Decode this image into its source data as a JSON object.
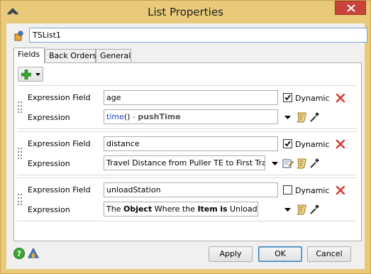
{
  "window": {
    "title": "List Properties"
  },
  "name_field": {
    "value": "TSList1"
  },
  "tabs": [
    {
      "label": "Fields"
    },
    {
      "label": "Back Orders"
    },
    {
      "label": "General"
    }
  ],
  "fields": [
    {
      "field_label": "Expression Field",
      "field_value": "age",
      "dynamic_label": "Dynamic",
      "dynamic_checked": true,
      "expression_label": "Expression",
      "expression_parts": {
        "func": "time",
        "paren": "()",
        "op": " - ",
        "var": "pushTime"
      }
    },
    {
      "field_label": "Expression Field",
      "field_value": "distance",
      "dynamic_label": "Dynamic",
      "dynamic_checked": true,
      "expression_label": "Expression",
      "expression_text": "Travel Distance from Puller TE to First Travel D"
    },
    {
      "field_label": "Expression Field",
      "field_value": "unloadStation",
      "dynamic_label": "Dynamic",
      "dynamic_checked": false,
      "expression_label": "Expression",
      "expression_parts": {
        "t1": "The ",
        "b1": "Object",
        "t2": " Where the ",
        "b2": "Item",
        "t3": " ",
        "b3": "is",
        "t4": " Unloaded"
      }
    }
  ],
  "buttons": {
    "apply": "Apply",
    "ok": "OK",
    "cancel": "Cancel"
  },
  "colors": {
    "titlebar": "#e9c97a",
    "close": "#c8443a",
    "delete_x": "#d9342b",
    "add_plus": "#3aa535"
  },
  "icons": [
    "flexsim-logo-icon",
    "close-icon",
    "object-icon",
    "add-icon",
    "dropdown-arrow-icon",
    "grip-icon",
    "delete-icon",
    "script-icon",
    "eyedropper-icon",
    "code-edit-icon",
    "help-icon",
    "tree-icon"
  ]
}
